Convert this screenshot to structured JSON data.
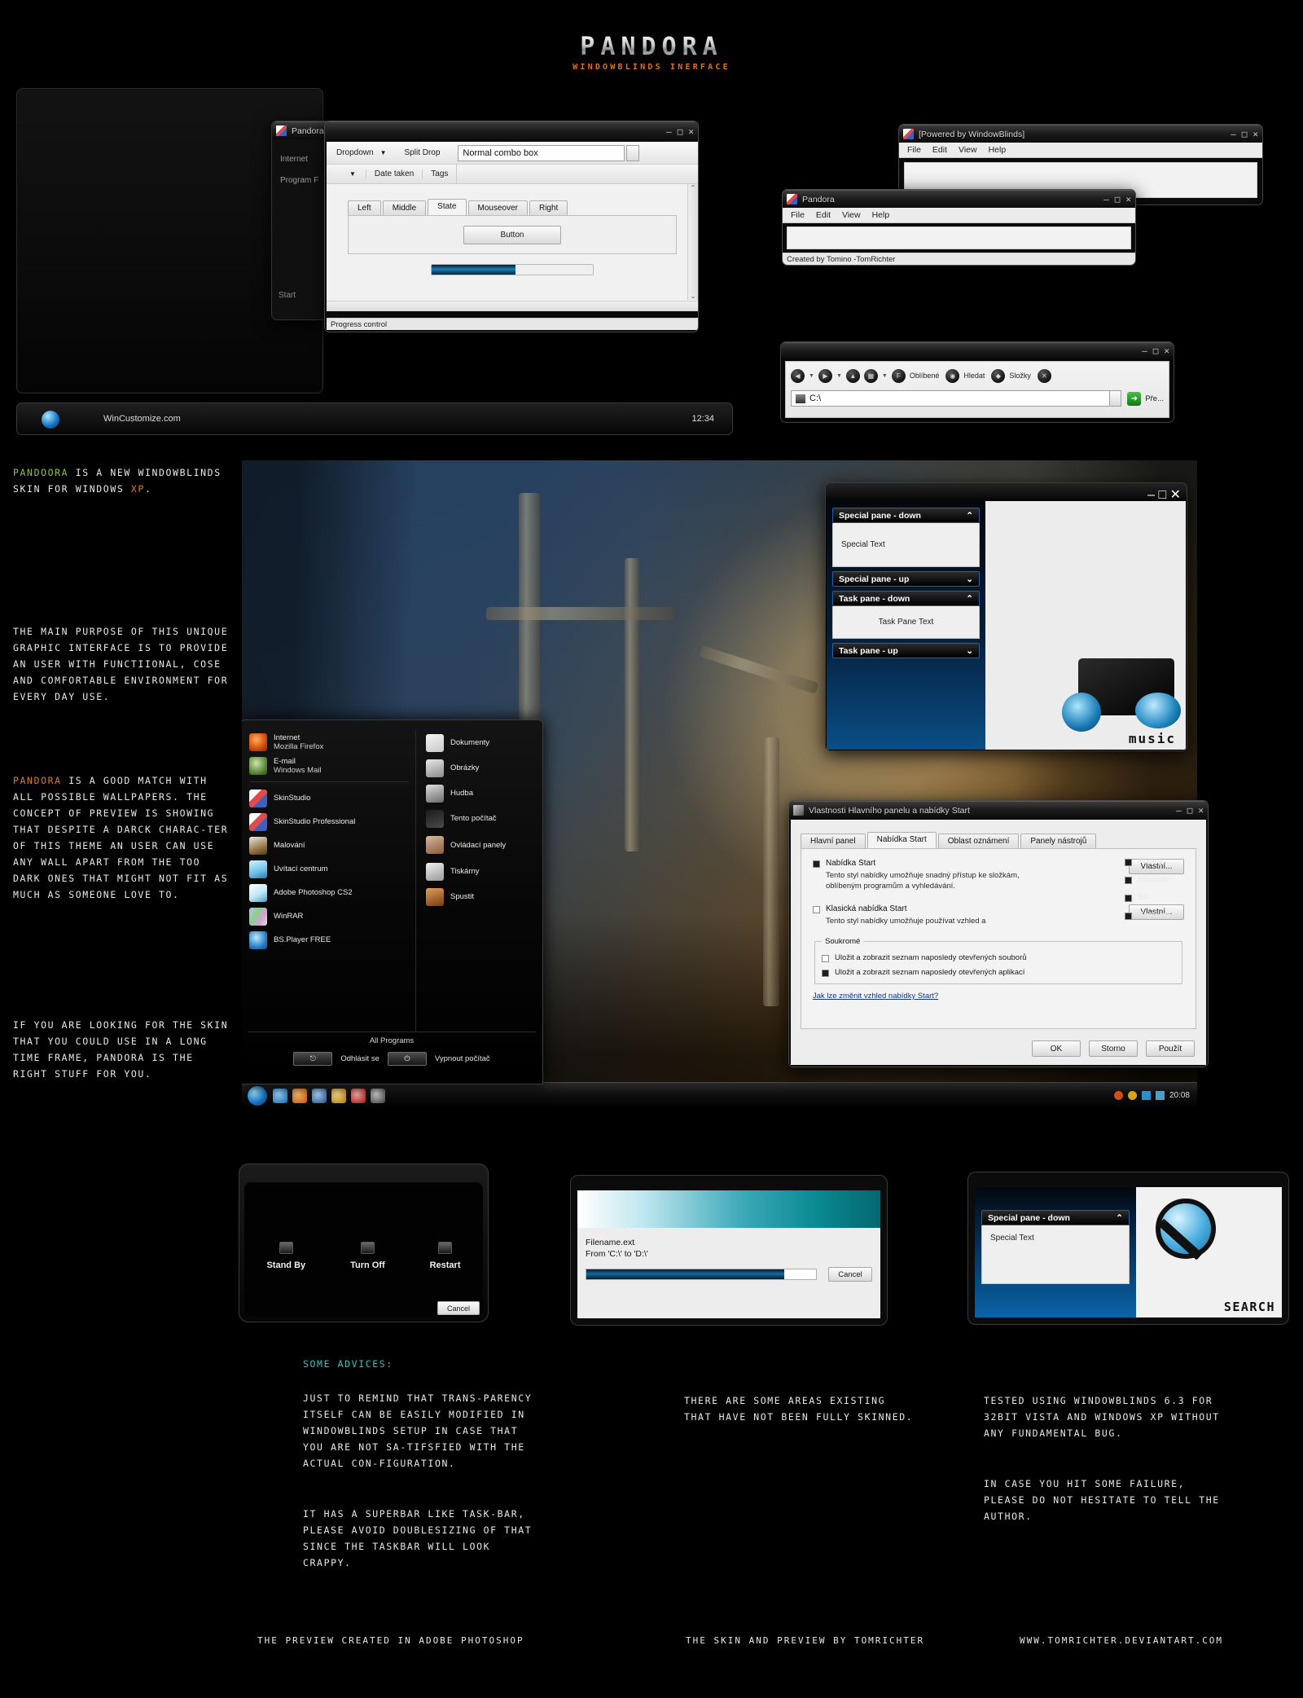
{
  "header": {
    "title": "PANDORA",
    "subtitle": "WINDOWBLINDS INERFACE"
  },
  "intro": {
    "p1_prefix": "PANDOORA",
    "p1_mid": " IS A NEW WINDOWBLINDS SKIN FOR WINDOWS ",
    "p1_hl": "XP",
    "p1_end": ".",
    "p2": "THE MAIN PURPOSE OF THIS UNIQUE GRAPHIC INTERFACE IS TO PROVIDE AN USER WITH FUNCTIIONAL, COSE AND COMFORTABLE ENVIRONMENT FOR EVERY DAY USE.",
    "p3_prefix": "PANDORA",
    "p3": " IS A GOOD MATCH WITH ALL POSSIBLE WALLPAPERS. THE CONCEPT OF PREVIEW IS SHOWING THAT DESPITE A DARCK CHARAC-TER OF THIS THEME AN USER CAN USE ANY WALL APART FROM THE TOO DARK ONES THAT MIGHT NOT FIT AS MUCH AS SOMEONE LOVE TO.",
    "p4": "IF YOU ARE LOOKING FOR THE SKIN THAT YOU COULD USE IN A LONG TIME FRAME, PANDORA IS THE RIGHT STUFF FOR YOU."
  },
  "advices": {
    "heading": "SOME ADVICES:",
    "col1_p1": "JUST TO REMIND THAT TRANS-PARENCY ITSELF CAN BE EASILY MODIFIED IN WINDOWBLINDS SETUP IN CASE THAT YOU ARE NOT SA-TIFSFIED WITH THE ACTUAL CON-FIGURATION.",
    "col1_p2": "IT HAS A SUPERBAR LIKE TASK-BAR, PLEASE AVOID DOUBLESIZING OF THAT SINCE THE TASKBAR WILL LOOK CRAPPY.",
    "col2_p1": "THERE ARE SOME AREAS EXISTING THAT HAVE NOT BEEN FULLY SKINNED.",
    "col3_p1": "TESTED USING WINDOWBLINDS 6.3 FOR 32BIT VISTA AND WINDOWS XP WITHOUT ANY FUNDAMENTAL BUG.",
    "col3_p2": "IN CASE YOU HIT SOME FAILURE, PLEASE DO NOT HESITATE TO TELL THE AUTHOR."
  },
  "footer": {
    "left": "THE PREVIEW CREATED IN ADOBE PHOTOSHOP",
    "middle": "THE SKIN AND PREVIEW BY TOMRICHTER",
    "right": "WWW.TOMRICHTER.DEVIANTART.COM"
  },
  "wincustomize_bar": {
    "label": "WinCustomize.com",
    "time": "12:34"
  },
  "widget_window": {
    "title": "Pandora",
    "minimize": "–",
    "maximize": "□",
    "close": "✕",
    "dropdown_label": "Dropdown",
    "split_drop_label": "Split Drop",
    "combo_value": "Normal combo box",
    "col_date": "Date taken",
    "col_tags": "Tags",
    "tabs": [
      "Left",
      "Middle",
      "State",
      "Mouseover",
      "Right"
    ],
    "active_tab": "State",
    "button_label": "Button",
    "progress_percent": 52,
    "status": "Progress control"
  },
  "behind_window": {
    "item1": "Internet",
    "item2": "Program F",
    "item3": "Start"
  },
  "wb_window": {
    "title": "[Powered by WindowBlinds]",
    "menu": [
      "File",
      "Edit",
      "View",
      "Help"
    ]
  },
  "pandora_window": {
    "title": "Pandora",
    "menu": [
      "File",
      "Edit",
      "View",
      "Help"
    ],
    "status": "Created by Tomino -TomRichter"
  },
  "explorer_window": {
    "title": "",
    "toolbar_labels": [
      "Oblíbené",
      "Hledat",
      "Složky"
    ],
    "address_value": "C:\\",
    "go_label": "Pře..."
  },
  "panes_window": {
    "special_down": "Special pane - down",
    "special_text": "Special Text",
    "special_up": "Special pane - up",
    "task_down": "Task pane - down",
    "task_text": "Task Pane Text",
    "task_up": "Task pane - up",
    "watermark": "music"
  },
  "taskbar_props": {
    "title": "Vlastnosti Hlavního panelu a nabídky Start",
    "tabs": [
      "Hlavní panel",
      "Nabídka Start",
      "Oblast oznámení",
      "Panely nástrojů"
    ],
    "active_tab": "Nabídka Start",
    "opt1_label": "Nabídka Start",
    "opt1_desc": "Tento styl nabídky umožňuje snadný přístup ke složkám, oblíbeným programům a vyhledávání.",
    "opt1_btn": "Vlastní...",
    "opt2_label": "Klasická nabídka Start",
    "opt2_desc": "Tento styl nabídky umožňuje používat vzhled a",
    "opt2_btn": "Vlastní...",
    "group_label": "Soukromé",
    "check1": "Uložit a zobrazit seznam naposledy otevřených souborů",
    "check2": "Uložit a zobrazit seznam naposledy otevřených aplikací",
    "link": "Jak lze změnit vzhled nabídky Start?",
    "ok": "OK",
    "cancel": "Storno",
    "apply": "Použít",
    "side_items": [
      "Hodiny",
      "Hlasitost",
      "Síť",
      "Napájení"
    ]
  },
  "start_menu": {
    "left_items": [
      {
        "title": "Internet",
        "sub": "Mozilla Firefox"
      },
      {
        "title": "E-mail",
        "sub": "Windows Mail"
      },
      {
        "title": "SkinStudio",
        "sub": ""
      },
      {
        "title": "SkinStudio Professional",
        "sub": ""
      },
      {
        "title": "Malování",
        "sub": ""
      },
      {
        "title": "Uvítací centrum",
        "sub": ""
      },
      {
        "title": "Adobe Photoshop CS2",
        "sub": ""
      },
      {
        "title": "WinRAR",
        "sub": ""
      },
      {
        "title": "BS.Player FREE",
        "sub": ""
      }
    ],
    "right_items": [
      "Dokumenty",
      "Obrázky",
      "Hudba",
      "Tento  počítač",
      "Ovládací panely",
      "Tiskárny",
      "Spustit"
    ],
    "all_programs": "All Programs",
    "logoff": "Odhlásit se",
    "shutdown": "Vypnout počítač"
  },
  "desktop_taskbar": {
    "time": "20:08"
  },
  "shutdown_dialog": {
    "standby": "Stand By",
    "turnoff": "Turn Off",
    "restart": "Restart",
    "cancel": "Cancel"
  },
  "copy_dialog": {
    "filename": "Filename.ext",
    "from_to": "From 'C:\\' to 'D:\\'",
    "cancel": "Cancel",
    "progress_percent": 86
  },
  "search_panel": {
    "pane_title": "Special pane - down",
    "pane_text": "Special Text",
    "watermark": "SEARCH"
  },
  "colors": {
    "accent_orange": "#e07a1f",
    "accent_green": "#8ec63f",
    "accent_cyan": "#2ec6c6",
    "progress_blue": "#1a7fb5"
  }
}
